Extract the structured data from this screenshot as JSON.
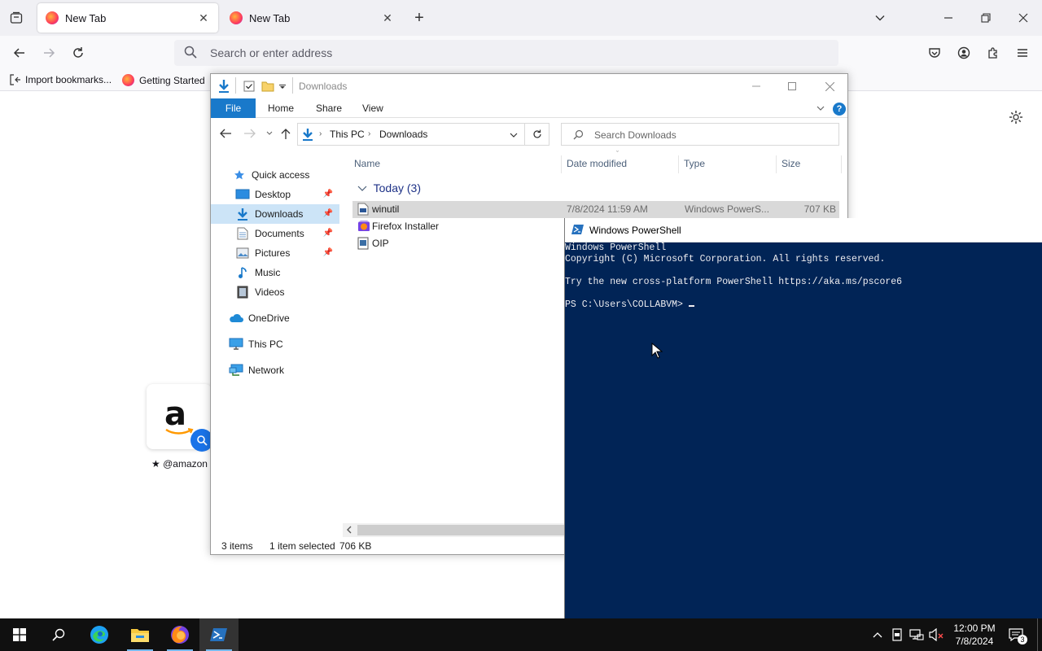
{
  "browser": {
    "tabs": [
      {
        "title": "New Tab",
        "active": true
      },
      {
        "title": "New Tab",
        "active": false
      }
    ],
    "url_placeholder": "Search or enter address",
    "bookmarks": [
      "Import bookmarks...",
      "Getting Started"
    ],
    "shortcut": {
      "label": "@amazon",
      "logo": "a"
    }
  },
  "explorer": {
    "title": "Downloads",
    "ribbon_tabs": [
      "File",
      "Home",
      "Share",
      "View"
    ],
    "help": "?",
    "breadcrumb": [
      "This PC",
      "Downloads"
    ],
    "search_placeholder": "Search Downloads",
    "nav": {
      "quick_access": "Quick access",
      "items": [
        "Desktop",
        "Downloads",
        "Documents",
        "Pictures",
        "Music",
        "Videos"
      ],
      "onedrive": "OneDrive",
      "this_pc": "This PC",
      "network": "Network"
    },
    "columns": [
      "Name",
      "Date modified",
      "Type",
      "Size"
    ],
    "group": "Today (3)",
    "files": [
      {
        "name": "winutil",
        "date": "7/8/2024 11:59 AM",
        "type": "Windows PowerS...",
        "size": "707 KB",
        "selected": true
      },
      {
        "name": "Firefox Installer",
        "date": "",
        "type": "",
        "size": "",
        "selected": false
      },
      {
        "name": "OIP",
        "date": "",
        "type": "",
        "size": "",
        "selected": false
      }
    ],
    "status": {
      "count": "3 items",
      "selection": "1 item selected",
      "size": "706 KB"
    }
  },
  "powershell": {
    "title": "Windows PowerShell",
    "lines": [
      "Windows PowerShell",
      "Copyright (C) Microsoft Corporation. All rights reserved.",
      "",
      "Try the new cross-platform PowerShell https://aka.ms/pscore6",
      "",
      "PS C:\\Users\\COLLABVM> "
    ]
  },
  "taskbar": {
    "time": "12:00 PM",
    "date": "7/8/2024",
    "notifications": "3"
  },
  "colors": {
    "ps_background": "#012456",
    "explorer_accent": "#1979ca",
    "selection": "#cce4f7",
    "taskbar": "#101010"
  }
}
